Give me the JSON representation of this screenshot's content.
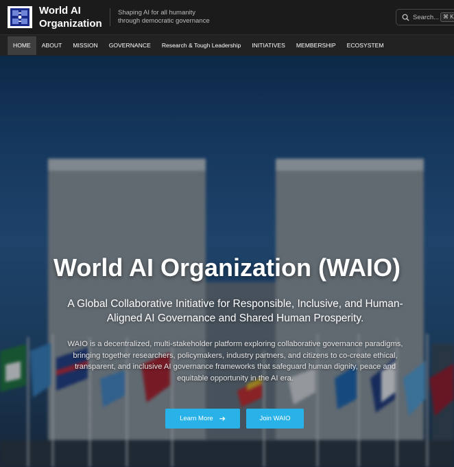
{
  "header": {
    "brand_line1": "World AI",
    "brand_line2": "Organization",
    "tagline_line1": "Shaping AI for all humanity",
    "tagline_line2": "through democratic governance",
    "search_placeholder": "Search...",
    "search_shortcut": "⌘ K"
  },
  "nav": {
    "items": [
      {
        "label": "HOME",
        "active": true
      },
      {
        "label": "ABOUT"
      },
      {
        "label": "MISSION"
      },
      {
        "label": "GOVERNANCE"
      },
      {
        "label": "Research & Tough Leadership"
      },
      {
        "label": "INITIATIVES"
      },
      {
        "label": "MEMBERSHIP"
      },
      {
        "label": "ECOSYSTEM"
      }
    ]
  },
  "hero": {
    "title": "World AI Organization (WAIO)",
    "subtitle": "A Global Collaborative Initiative for Responsible, Inclusive, and Human-Aligned AI Governance and Shared Human Prosperity.",
    "description": "WAIO is a decentralized, multi-stakeholder platform exploring collaborative governance paradigms, bringing together researchers, policymakers, industry partners, and citizens to co-create ethical, transparent, and inclusive AI governance frameworks that safeguard human dignity, peace and equitable opportunity in the AI era.",
    "primary_button": "Learn More",
    "secondary_button": "Join WAIO",
    "accent_color": "#29b2e8"
  },
  "icons": {
    "logo": "waio-logo-icon",
    "search": "search-icon",
    "arrow": "arrow-right-icon"
  }
}
